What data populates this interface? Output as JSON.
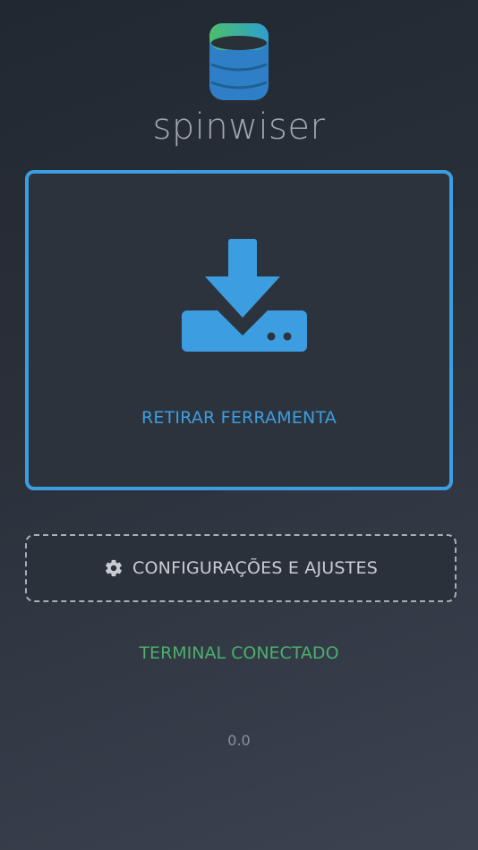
{
  "app": {
    "brand": "spinwiser"
  },
  "actions": {
    "withdraw_label": "RETIRAR FERRAMENTA",
    "settings_label": "CONFIGURAÇÕES E AJUSTES"
  },
  "status": {
    "text": "TERMINAL CONECTADO"
  },
  "footer": {
    "version": "0.0"
  },
  "icons": {
    "logo": "database-stack-icon",
    "withdraw": "download-to-drive-icon",
    "settings": "gear-icon"
  },
  "colors": {
    "accent": "#3c9ee0",
    "status_ok": "#4caf6e",
    "logo_green": "#4cbf6a",
    "text_muted": "#a2a8b0"
  }
}
